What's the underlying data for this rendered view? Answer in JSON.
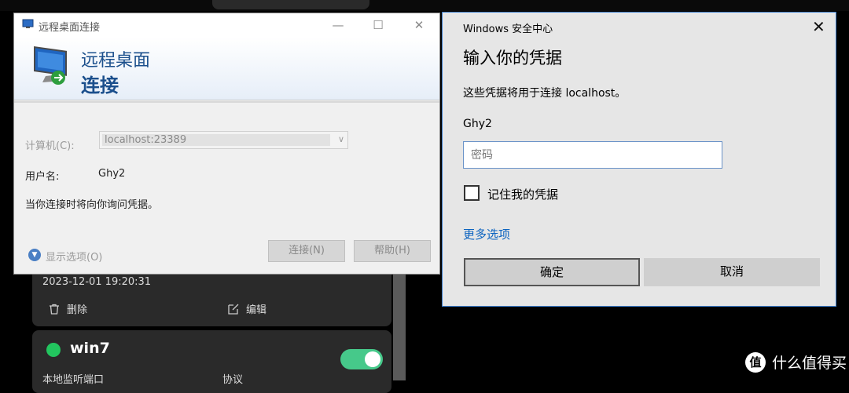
{
  "background": {
    "card1": {
      "timestamp": "2023-12-01 19:20:31",
      "delete_label": "删除",
      "edit_label": "编辑"
    },
    "card2": {
      "name": "win7",
      "status_color": "#22c55e",
      "toggle_on": true,
      "label_left": "本地监听端口",
      "label_right": "协议"
    },
    "watermark": {
      "logo": "值",
      "text": "什么值得买"
    }
  },
  "rdp_window": {
    "title": "远程桌面连接",
    "banner_line1": "远程桌面",
    "banner_line2": "连接",
    "computer_label": "计算机(C):",
    "computer_value": "localhost:23389",
    "username_label": "用户名:",
    "username_value": "Ghy2",
    "hint": "当你连接时将向你询问凭据。",
    "options_label": "显示选项(O)",
    "connect_button": "连接(N)",
    "help_button": "帮助(H)"
  },
  "security_dialog": {
    "title": "Windows 安全中心",
    "heading": "输入你的凭据",
    "description": "这些凭据将用于连接 localhost。",
    "username": "Ghy2",
    "password_placeholder": "密码",
    "remember_label": "记住我的凭据",
    "remember_checked": false,
    "more_options": "更多选项",
    "ok_button": "确定",
    "cancel_button": "取消",
    "accent_color": "#3a7ac8"
  }
}
